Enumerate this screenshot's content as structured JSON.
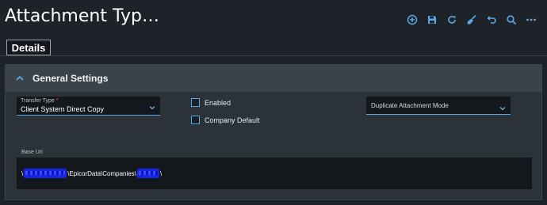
{
  "header": {
    "title": "Attachment Typ…",
    "toolbar": [
      {
        "icon": "add-icon"
      },
      {
        "icon": "save-icon"
      },
      {
        "icon": "refresh-icon"
      },
      {
        "icon": "clear-icon"
      },
      {
        "icon": "undo-icon"
      },
      {
        "icon": "search-icon"
      },
      {
        "icon": "more-icon"
      }
    ]
  },
  "tabs": [
    {
      "label": "Details"
    }
  ],
  "panel": {
    "title": "General Settings",
    "transfer_type": {
      "label": "Transfer Type",
      "required_mark": "*",
      "value": "Client System Direct Copy"
    },
    "enabled": {
      "label": "Enabled",
      "checked": false
    },
    "company_default": {
      "label": "Company Default",
      "checked": false
    },
    "duplicate_mode": {
      "value": "Duplicate Attachment Mode"
    },
    "base_uri": {
      "label": "Base Uri",
      "prefix": "\\",
      "middle": "\\EpicorData\\Companies\\",
      "suffix": "\\"
    }
  },
  "colors": {
    "background": "#1e2329",
    "panel": "#2c3338",
    "accent": "#5aa9e6",
    "redaction": "#1424e8"
  }
}
